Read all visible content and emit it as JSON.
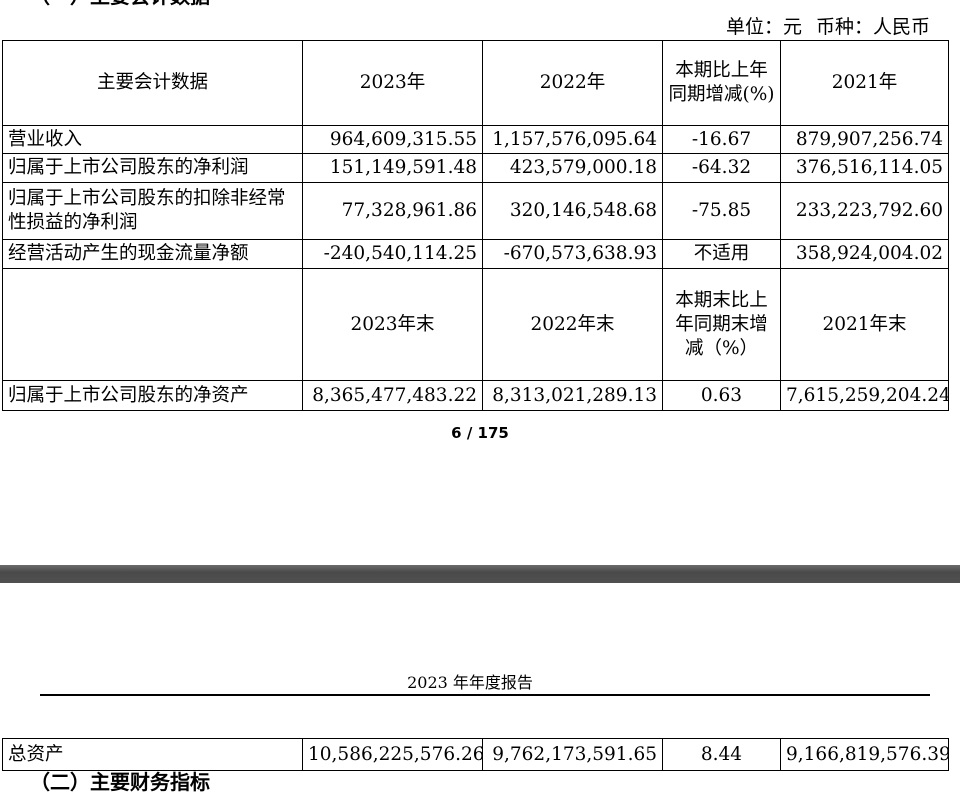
{
  "section_heading": "（一）主要会计数据",
  "unit_label": "单位：元",
  "currency_label": "币种：人民币",
  "table": {
    "header": [
      "主要会计数据",
      "2023年",
      "2022年",
      "本期比上年同期增减(%)",
      "2021年"
    ],
    "rows": [
      {
        "label": "营业收入",
        "y2023": "964,609,315.55",
        "y2022": "1,157,576,095.64",
        "change": "-16.67",
        "y2021": "879,907,256.74"
      },
      {
        "label": "归属于上市公司股东的净利润",
        "y2023": "151,149,591.48",
        "y2022": "423,579,000.18",
        "change": "-64.32",
        "y2021": "376,516,114.05"
      },
      {
        "label": "归属于上市公司股东的扣除非经常性损益的净利润",
        "y2023": "77,328,961.86",
        "y2022": "320,146,548.68",
        "change": "-75.85",
        "y2021": "233,223,792.60"
      },
      {
        "label": "经营活动产生的现金流量净额",
        "y2023": "-240,540,114.25",
        "y2022": "-670,573,638.93",
        "change": "不适用",
        "y2021": "358,924,004.02"
      }
    ],
    "header2": [
      "",
      "2023年末",
      "2022年末",
      "本期末比上年同期末增减（%）",
      "2021年末"
    ],
    "rows2": [
      {
        "label": "归属于上市公司股东的净资产",
        "y2023": "8,365,477,483.22",
        "y2022": "8,313,021,289.13",
        "change": "0.63",
        "y2021": "7,615,259,204.24"
      }
    ]
  },
  "page_number": "6 / 175",
  "running_header": "2023 年年度报告",
  "continued_rows": [
    {
      "label": "总资产",
      "y2023": "10,586,225,576.26",
      "y2022": "9,762,173,591.65",
      "change": "8.44",
      "y2021": "9,166,819,576.39"
    }
  ],
  "next_heading": "（二）主要财务指标"
}
